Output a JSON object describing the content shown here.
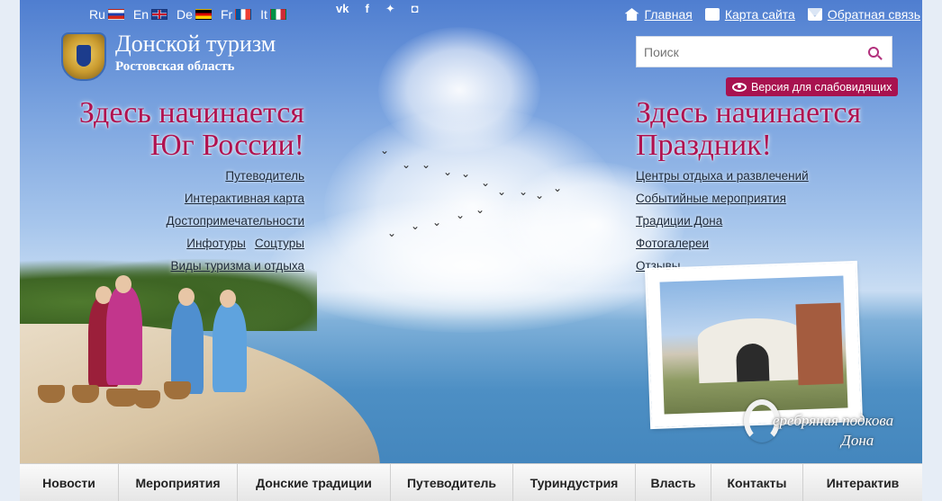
{
  "languages": [
    {
      "code": "Ru",
      "flag": "flag-ru"
    },
    {
      "code": "En",
      "flag": "flag-en"
    },
    {
      "code": "De",
      "flag": "flag-de"
    },
    {
      "code": "Fr",
      "flag": "flag-fr"
    },
    {
      "code": "It",
      "flag": "flag-it"
    }
  ],
  "social": [
    "vk-icon",
    "facebook-icon",
    "twitter-icon",
    "instagram-icon"
  ],
  "top_links": [
    {
      "label": "Главная",
      "icon": "home-icon"
    },
    {
      "label": "Карта сайта",
      "icon": "sitemap-icon"
    },
    {
      "label": "Обратная связь",
      "icon": "mail-icon"
    }
  ],
  "logo": {
    "title": "Донской туризм",
    "subtitle": "Ростовская область"
  },
  "search": {
    "placeholder": "Поиск"
  },
  "accessibility": {
    "label": "Версия для слабовидящих"
  },
  "slogan_left": {
    "line1": "Здесь начинается",
    "line2": "Юг России!"
  },
  "slogan_right": {
    "line1": "Здесь начинается",
    "line2": "Праздник!"
  },
  "links_left": [
    "Путеводитель",
    "Интерактивная карта",
    "Достопримечательности",
    "Инфотуры",
    "Соцтуры",
    "Виды туризма и отдыха"
  ],
  "links_right": [
    "Центры отдыха и развлечений",
    "Событийные мероприятия",
    "Традиции Дона",
    "Фотогалереи",
    "Отзывы"
  ],
  "brand": {
    "line1": "еребряная подкова",
    "line2": "Дона"
  },
  "nav": [
    "Новости",
    "Мероприятия",
    "Донские традиции",
    "Путеводитель",
    "Туриндустрия",
    "Власть",
    "Контакты",
    "Интерактив"
  ],
  "colors": {
    "accent": "#b0124f",
    "button": "#a8124f"
  }
}
